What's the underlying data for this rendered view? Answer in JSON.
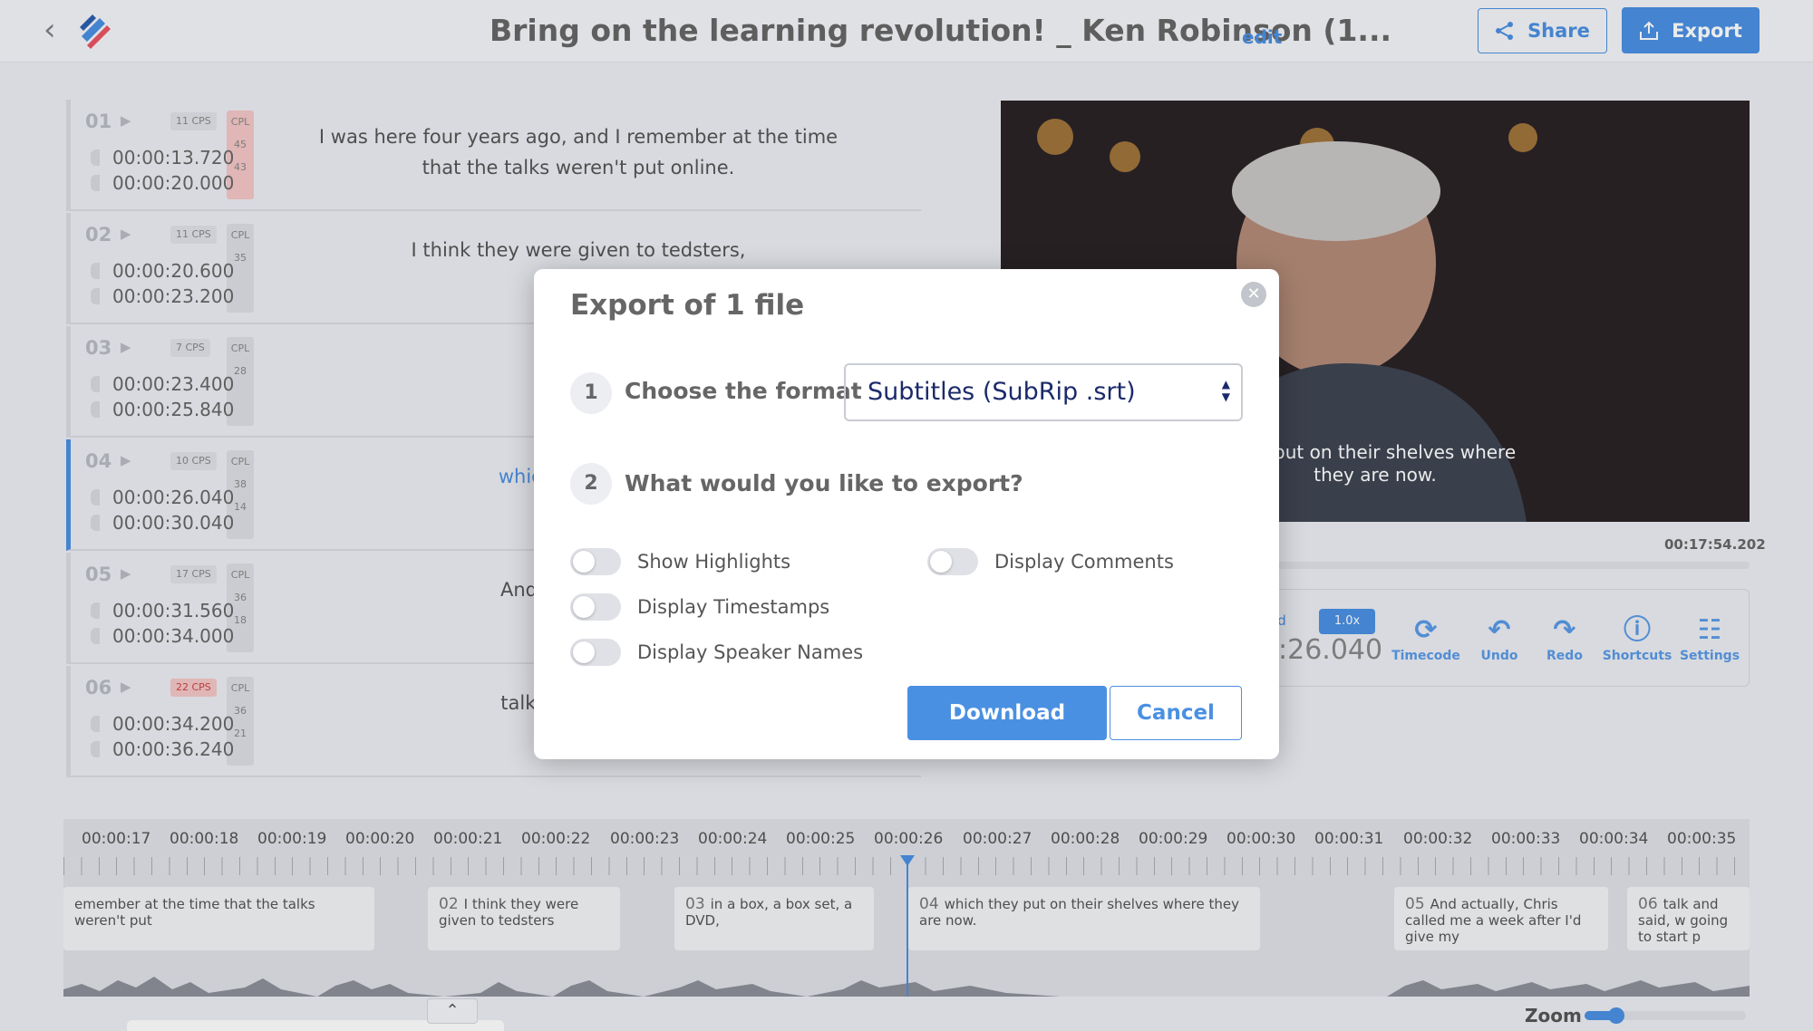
{
  "header": {
    "back_icon": "chevron-left-icon",
    "title": "Bring on the learning revolution! _ Ken Robinson (1...",
    "edit_label": "edit",
    "share_label": "Share",
    "export_label": "Export"
  },
  "subtitles": [
    {
      "num": "01",
      "cps": "11 CPS",
      "cps_warn": false,
      "cpl_label": "CPL",
      "cpl": [
        "45",
        "43"
      ],
      "cpl_warn": true,
      "start": "00:00:13.720",
      "end": "00:00:20.000",
      "text": "I was here four years ago, and I remember at the time that the talks weren't put online."
    },
    {
      "num": "02",
      "cps": "11 CPS",
      "cps_warn": false,
      "cpl_label": "CPL",
      "cpl": [
        "35"
      ],
      "cpl_warn": false,
      "start": "00:00:20.600",
      "end": "00:00:23.200",
      "text": "I think they were given to tedsters,"
    },
    {
      "num": "03",
      "cps": "7 CPS",
      "cps_warn": false,
      "cpl_label": "CPL",
      "cpl": [
        "28"
      ],
      "cpl_warn": false,
      "start": "00:00:23.400",
      "end": "00:00:25.840",
      "text": "in a box,"
    },
    {
      "num": "04",
      "cps": "10 CPS",
      "cps_warn": false,
      "cpl_label": "CPL",
      "cpl": [
        "38",
        "14"
      ],
      "cpl_warn": false,
      "start": "00:00:26.040",
      "end": "00:00:30.040",
      "text": "which they pu th"
    },
    {
      "num": "05",
      "cps": "17 CPS",
      "cps_warn": false,
      "cpl_label": "CPL",
      "cpl": [
        "36",
        "18"
      ],
      "cpl_warn": false,
      "start": "00:00:31.560",
      "end": "00:00:34.000",
      "text": "And actually, aft"
    },
    {
      "num": "06",
      "cps": "22 CPS",
      "cps_warn": true,
      "cpl_label": "CPL",
      "cpl": [
        "36",
        "21"
      ],
      "cpl_warn": false,
      "start": "00:00:34.200",
      "end": "00:00:36.240",
      "text": "talk and sa putti"
    }
  ],
  "video": {
    "caption_line1": "hey put on their shelves where",
    "caption_line2": "they are now.",
    "duration": "00:17:54.202"
  },
  "controls": {
    "speed_label": "ed",
    "speed_value": "1.0x",
    "timecode_value": ":26.040",
    "items": [
      {
        "label": "Timecode",
        "icon": "timecode-icon"
      },
      {
        "label": "Undo",
        "icon": "undo-icon"
      },
      {
        "label": "Redo",
        "icon": "redo-icon"
      },
      {
        "label": "Shortcuts",
        "icon": "info-icon"
      },
      {
        "label": "Settings",
        "icon": "sliders-icon"
      }
    ]
  },
  "timeline": {
    "ticks": [
      "00:00:17",
      "00:00:18",
      "00:00:19",
      "00:00:20",
      "00:00:21",
      "00:00:22",
      "00:00:23",
      "00:00:24",
      "00:00:25",
      "00:00:26",
      "00:00:27",
      "00:00:28",
      "00:00:29",
      "00:00:30",
      "00:00:31",
      "00:00:32",
      "00:00:33",
      "00:00:34",
      "00:00:35"
    ],
    "blocks": [
      {
        "num": "",
        "text": "emember at the time that the talks weren't put"
      },
      {
        "num": "02",
        "text": "I think they were given to tedsters"
      },
      {
        "num": "03",
        "text": "in a box, a box set, a DVD,"
      },
      {
        "num": "04",
        "text": "which they put on their shelves where they are now."
      },
      {
        "num": "05",
        "text": "And actually, Chris called me a week after I'd give my"
      },
      {
        "num": "06",
        "text": "talk and said, w going to start p"
      }
    ],
    "zoom_label": "Zoom",
    "collapse_icon": "chevron-up-icon"
  },
  "modal": {
    "title": "Export of 1 file",
    "step1_num": "1",
    "step1_label": "Choose the format",
    "format_value": "Subtitles (SubRip .srt)",
    "step2_num": "2",
    "step2_label": "What would you like to export?",
    "toggles": [
      {
        "label": "Show Highlights",
        "on": false
      },
      {
        "label": "Display Comments",
        "on": false
      },
      {
        "label": "Display Timestamps",
        "on": false
      },
      {
        "label": "Display Speaker Names",
        "on": false
      }
    ],
    "download_label": "Download",
    "cancel_label": "Cancel"
  }
}
